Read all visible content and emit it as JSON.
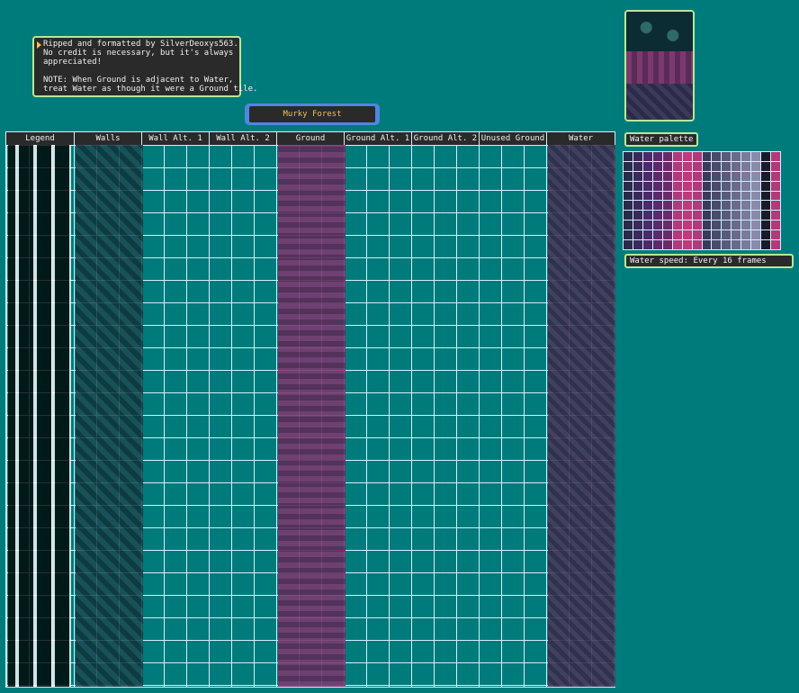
{
  "credits": {
    "line1": "Ripped and formatted by SilverDeoxys563.",
    "line2": "No credit is necessary, but it's always",
    "line3": "appreciated!",
    "line4": "NOTE: When Ground is adjacent to Water,",
    "line5": "treat Water as though it were a Ground tile."
  },
  "title": "Murky Forest",
  "headers": [
    "Legend",
    "Walls",
    "Wall Alt. 1",
    "Wall Alt. 2",
    "Ground",
    "Ground Alt. 1",
    "Ground Alt. 2",
    "Unused Ground",
    "Water"
  ],
  "water_palette_label": "Water palette",
  "water_speed": "Water speed: Every 16 frames"
}
